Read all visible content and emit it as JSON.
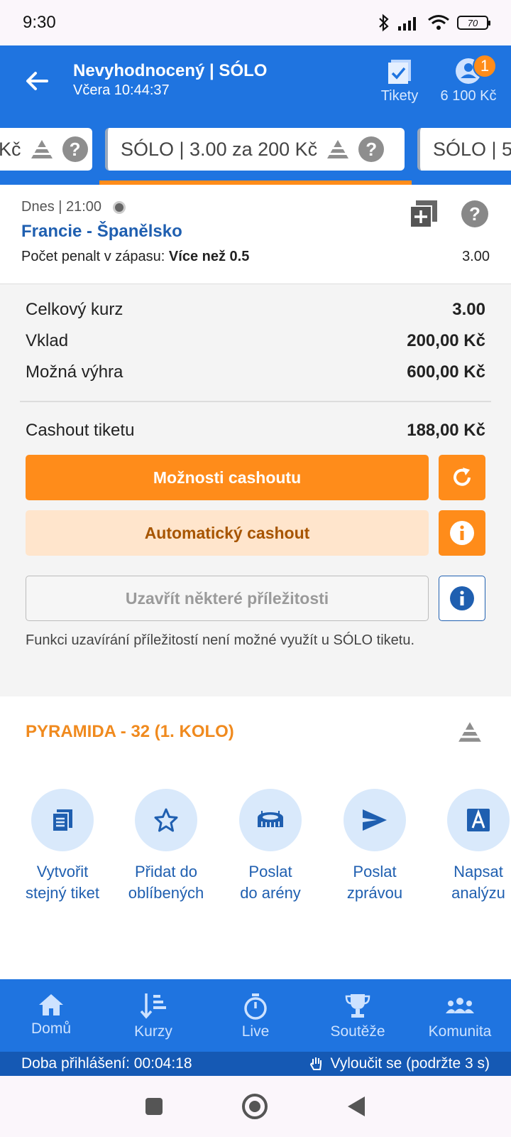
{
  "status_bar": {
    "time": "9:30",
    "battery": "70"
  },
  "header": {
    "title": "Nevyhodnocený | SÓLO",
    "subtitle": "Včera 10:44:37",
    "tickets_label": "Tikety",
    "balance": "6 100 Kč",
    "notification_count": "1"
  },
  "ticket_tabs": [
    {
      "label": "Kč"
    },
    {
      "label": "SÓLO  | 3.00 za 200 Kč"
    },
    {
      "label": "SÓLO  | 5"
    }
  ],
  "match": {
    "date": "Dnes  | 21:00",
    "name": "Francie - Španělsko",
    "pick_label": "Počet penalt v zápasu: ",
    "pick_value": "Více než 0.5",
    "odds": "3.00"
  },
  "summary": {
    "total_odds_label": "Celkový kurz",
    "total_odds": "3.00",
    "stake_label": "Vklad",
    "stake": "200,00 Kč",
    "win_label": "Možná výhra",
    "win": "600,00 Kč",
    "cashout_label": "Cashout tiketu",
    "cashout": "188,00 Kč"
  },
  "buttons": {
    "cashout_options": "Možnosti cashoutu",
    "auto_cashout": "Automatický cashout",
    "close_opportunities": "Uzavřít některé příležitosti",
    "note": "Funkci uzavírání příležitostí není možné využít u SÓLO tiketu."
  },
  "pyramid": {
    "title": "PYRAMIDA - 32 (1. KOLO)"
  },
  "actions": [
    {
      "line1": "Vytvořit",
      "line2": "stejný tiket",
      "icon": "document-icon"
    },
    {
      "line1": "Přidat do",
      "line2": "oblíbených",
      "icon": "star-icon"
    },
    {
      "line1": "Poslat",
      "line2": "do arény",
      "icon": "arena-icon"
    },
    {
      "line1": "Poslat",
      "line2": "zprávou",
      "icon": "send-icon"
    },
    {
      "line1": "Napsat",
      "line2": "analýzu",
      "icon": "letter-a-icon"
    }
  ],
  "bottom_nav": [
    {
      "label": "Domů",
      "icon": "home-icon"
    },
    {
      "label": "Kurzy",
      "icon": "odds-icon"
    },
    {
      "label": "Live",
      "icon": "stopwatch-icon"
    },
    {
      "label": "Soutěže",
      "icon": "trophy-icon"
    },
    {
      "label": "Komunita",
      "icon": "community-icon"
    }
  ],
  "login_bar": {
    "duration": "Doba přihlášení: 00:04:18",
    "exclude": "Vyloučit se (podržte 3 s)"
  },
  "colors": {
    "primary": "#1f74e0",
    "accent": "#ff8c1a",
    "link": "#1f5fb0"
  }
}
